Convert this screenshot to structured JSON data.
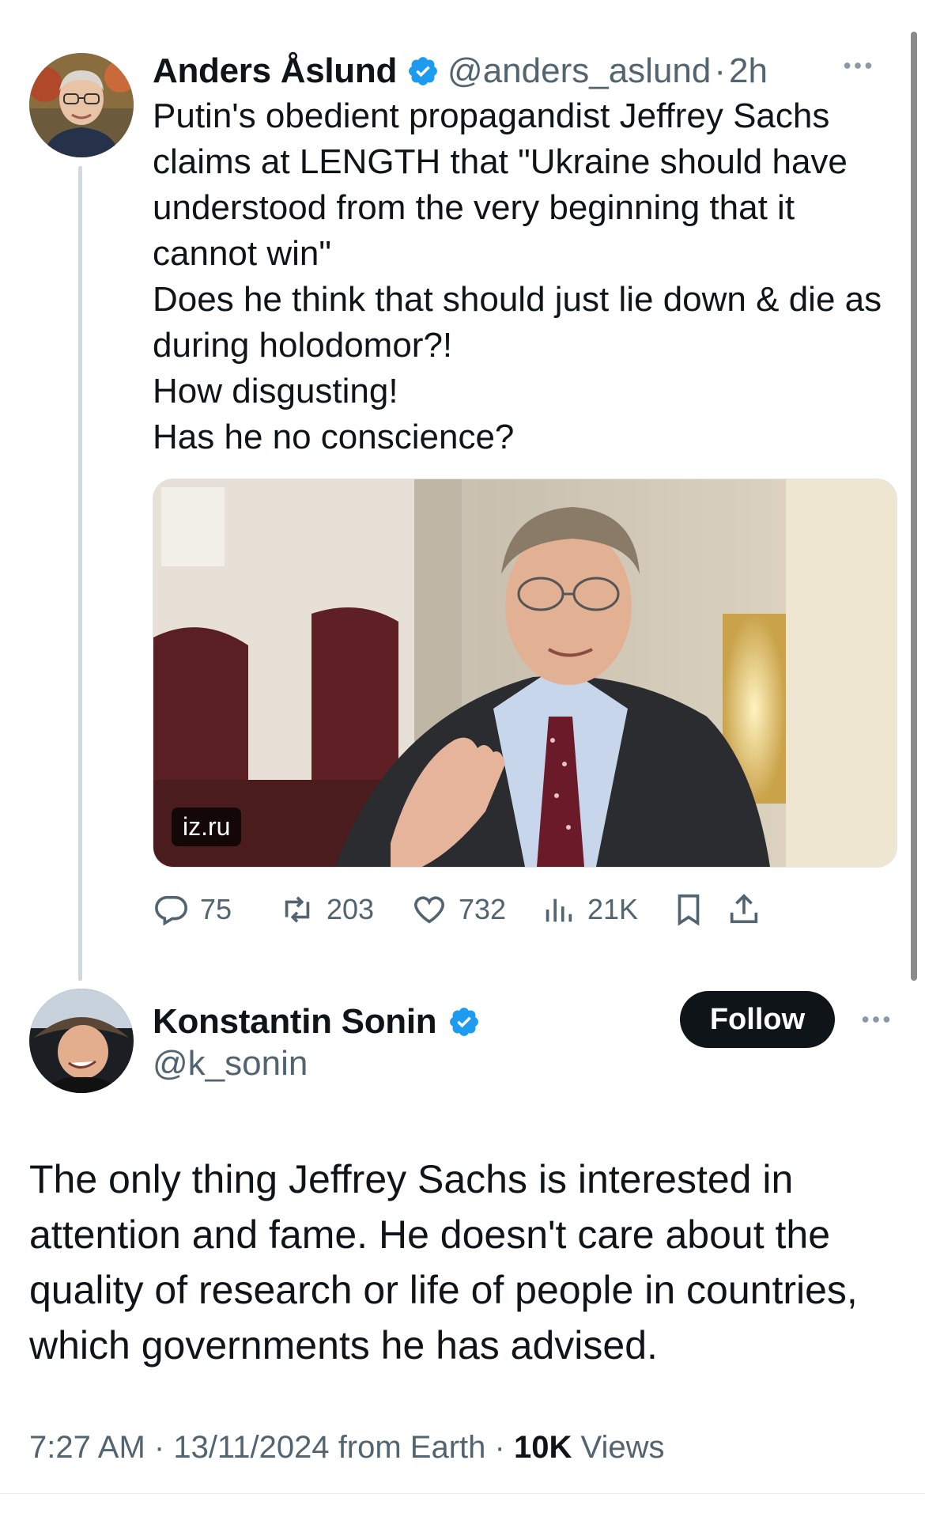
{
  "quoted": {
    "author_name": "Anders Åslund",
    "handle": "@anders_aslund",
    "separator": "·",
    "time": "2h",
    "text_lines": [
      "Putin's obedient propagandist Jeffrey Sachs claims at LENGTH that \"Ukraine should have understood from the very beginning that it cannot win\"",
      "Does he think that should just lie down & die as during holodomor?!",
      "How disgusting!",
      "Has he no conscience?"
    ],
    "media_source": "iz.ru",
    "stats": {
      "replies": "75",
      "reposts": "203",
      "likes": "732",
      "views": "21K"
    }
  },
  "main": {
    "author_name": "Konstantin Sonin",
    "handle": "@k_sonin",
    "follow_label": "Follow",
    "text": "The only thing Jeffrey Sachs is interested in attention and fame. He doesn't care about the quality of research or life of people in countries, which governments he has advised.",
    "time": "7:27 AM",
    "date": "13/11/2024",
    "source": "from Earth",
    "views_count": "10K",
    "views_label": "Views"
  },
  "colors": {
    "verified_blue": "#1d9bf0",
    "secondary_text": "#536471",
    "follow_button": "#0f1419"
  },
  "icons": {
    "more": "more-icon",
    "reply": "reply-icon",
    "repost": "repost-icon",
    "like": "heart-icon",
    "views": "views-icon",
    "bookmark": "bookmark-icon",
    "share": "share-icon",
    "verified": "verified-badge-icon"
  }
}
